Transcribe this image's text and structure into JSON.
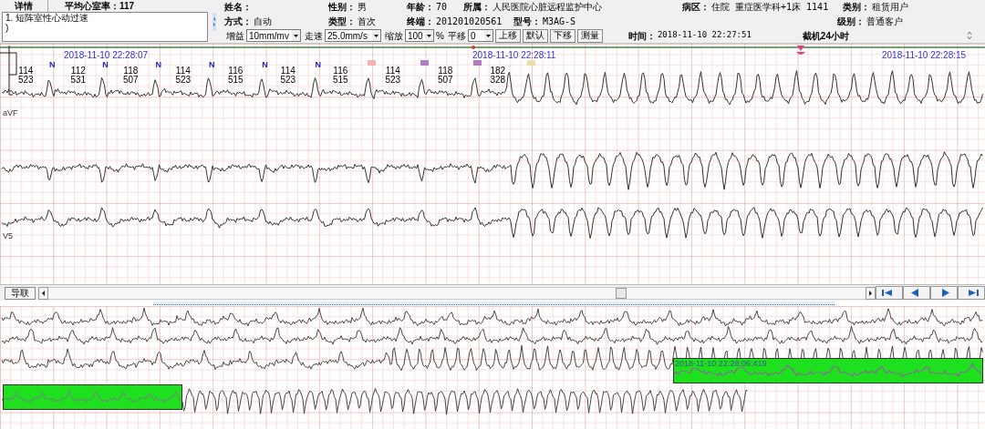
{
  "summary": {
    "tab": "详情",
    "average_rate": "平均心室率：117"
  },
  "diagnosis": [
    "1. 短阵室性心动过速",
    ")"
  ],
  "patient_rows": [
    [
      {
        "label": "姓名："
      },
      {
        "label": "性别：",
        "value": "男"
      },
      {
        "label": "年龄：",
        "value": "70"
      },
      {
        "label": "所属：",
        "value": "人民医院心脏远程监护中心"
      },
      {
        "label": "病区：",
        "value": "住院 重症医学科+1床 1141"
      },
      {
        "label": "类别：",
        "value": "租赁用户"
      }
    ],
    [
      {
        "label": "方式：",
        "value": "自动"
      },
      {
        "label": "类型：",
        "value": "首次"
      },
      {
        "label": "终端：",
        "value": "201201020561"
      },
      {
        "label": "型号：",
        "value": "M3AG-S"
      },
      {
        "label": "级别：",
        "value": "普通客户"
      }
    ]
  ],
  "controls": [
    {
      "label": "增益",
      "value": "10mm/mv"
    },
    {
      "label": "走速",
      "value": "25.0mm/s"
    },
    {
      "label": "缩放",
      "value": "100",
      "unit": "%"
    },
    {
      "label": "平移",
      "value": "0"
    }
  ],
  "buttons": [
    "上移",
    "默认",
    "下移",
    "测量"
  ],
  "time": {
    "label": "时间：",
    "value": "2018-11-10 22:27:51"
  },
  "record_mode": "截机24小时",
  "ecg": {
    "timestamps": [
      "2018-11-10 22:28:07",
      "2018-11-10 22:28:11",
      "2018-11-10 22:28:15"
    ],
    "lead_labels": [
      "aVF",
      "V5"
    ],
    "beats": [
      {
        "rate": "114",
        "interval": "523"
      },
      {
        "rate": "112",
        "interval": "531"
      },
      {
        "rate": "118",
        "interval": "507"
      },
      {
        "rate": "114",
        "interval": "523"
      },
      {
        "rate": "116",
        "interval": "515"
      },
      {
        "rate": "114",
        "interval": "523"
      },
      {
        "rate": "116",
        "interval": "515"
      },
      {
        "rate": "114",
        "interval": "523"
      },
      {
        "rate": "118",
        "interval": "507"
      },
      {
        "rate": "182",
        "interval": "328"
      }
    ],
    "beat_marks": [
      {
        "kind": "letter",
        "text": "N"
      },
      {
        "kind": "letter",
        "text": "N"
      },
      {
        "kind": "letter",
        "text": "N"
      },
      {
        "kind": "letter",
        "text": "N"
      },
      {
        "kind": "letter",
        "text": "N"
      },
      {
        "kind": "letter",
        "text": "N"
      },
      {
        "kind": "dot",
        "color": "#f4b0b4"
      },
      {
        "kind": "dot",
        "color": "#b07cc4"
      },
      {
        "kind": "dot",
        "color": "#b07cc4"
      },
      {
        "kind": "dot",
        "color": "#e6e2a8"
      }
    ]
  },
  "lead_button": "导联",
  "overview": {
    "highlights": [
      {
        "kind": "labeled",
        "timestamp": "2018-11-10 22:28:06:419"
      },
      {
        "kind": "plain"
      }
    ]
  }
}
